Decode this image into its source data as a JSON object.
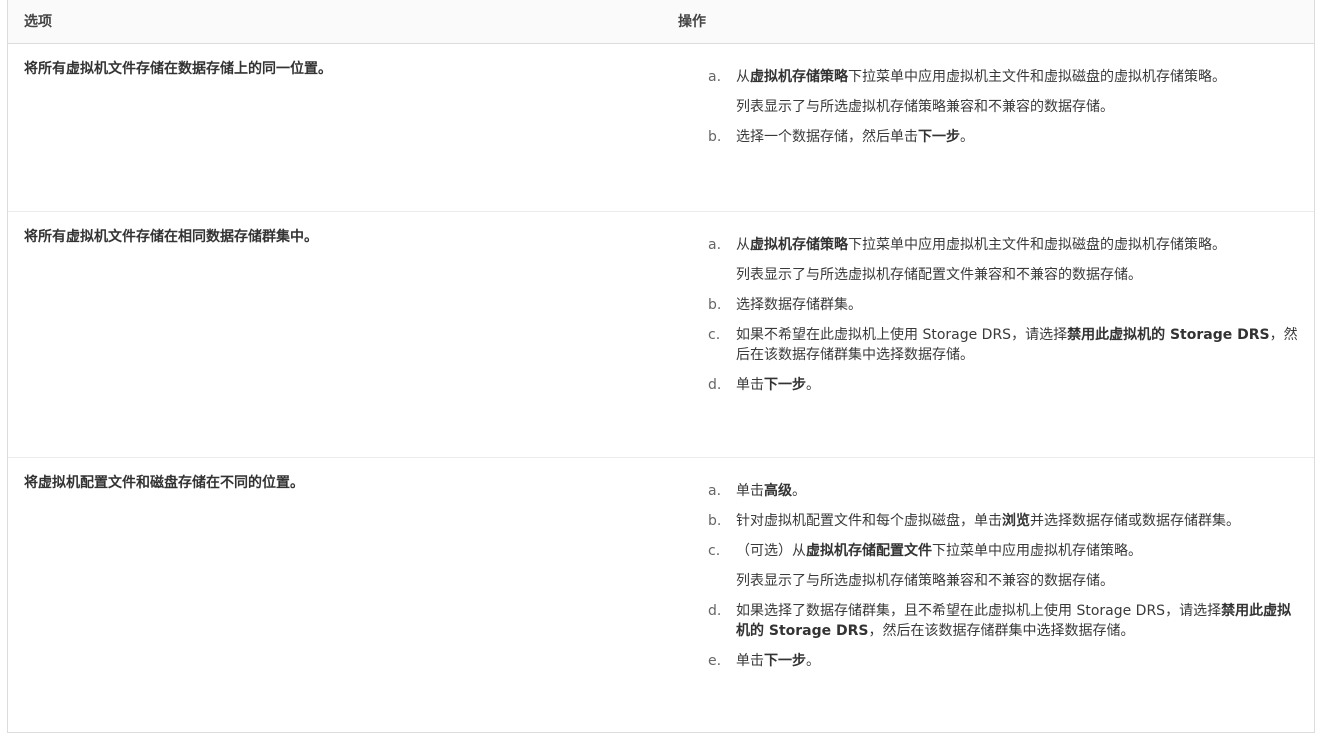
{
  "header": {
    "option": "选项",
    "action": "操作"
  },
  "rows": [
    {
      "option": "将所有虚拟机文件存储在数据存储上的同一位置。",
      "steps": [
        {
          "marker": "a.",
          "parts": [
            {
              "t": "从"
            },
            {
              "t": "虚拟机存储策略",
              "b": true
            },
            {
              "t": "下拉菜单中应用虚拟机主文件和虚拟磁盘的虚拟机存储策略。"
            }
          ],
          "note": "列表显示了与所选虚拟机存储策略兼容和不兼容的数据存储。"
        },
        {
          "marker": "b.",
          "parts": [
            {
              "t": "选择一个数据存储，然后单击"
            },
            {
              "t": "下一步",
              "b": true
            },
            {
              "t": "。"
            }
          ]
        }
      ]
    },
    {
      "option": "将所有虚拟机文件存储在相同数据存储群集中。",
      "steps": [
        {
          "marker": "a.",
          "parts": [
            {
              "t": "从"
            },
            {
              "t": "虚拟机存储策略",
              "b": true
            },
            {
              "t": "下拉菜单中应用虚拟机主文件和虚拟磁盘的虚拟机存储策略。"
            }
          ],
          "note": "列表显示了与所选虚拟机存储配置文件兼容和不兼容的数据存储。"
        },
        {
          "marker": "b.",
          "parts": [
            {
              "t": "选择数据存储群集。"
            }
          ]
        },
        {
          "marker": "c.",
          "parts": [
            {
              "t": "如果不希望在此虚拟机上使用 Storage DRS，请选择"
            },
            {
              "t": "禁用此虚拟机的 Storage DRS",
              "b": true
            },
            {
              "t": "，然后在该数据存储群集中选择数据存储。"
            }
          ]
        },
        {
          "marker": "d.",
          "parts": [
            {
              "t": "单击"
            },
            {
              "t": "下一步",
              "b": true
            },
            {
              "t": "。"
            }
          ]
        }
      ]
    },
    {
      "option": "将虚拟机配置文件和磁盘存储在不同的位置。",
      "steps": [
        {
          "marker": "a.",
          "parts": [
            {
              "t": "单击"
            },
            {
              "t": "高级",
              "b": true
            },
            {
              "t": "。"
            }
          ]
        },
        {
          "marker": "b.",
          "parts": [
            {
              "t": "针对虚拟机配置文件和每个虚拟磁盘，单击"
            },
            {
              "t": "浏览",
              "b": true
            },
            {
              "t": "并选择数据存储或数据存储群集。"
            }
          ]
        },
        {
          "marker": "c.",
          "parts": [
            {
              "t": "（可选）从"
            },
            {
              "t": "虚拟机存储配置文件",
              "b": true
            },
            {
              "t": "下拉菜单中应用虚拟机存储策略。"
            }
          ],
          "note": "列表显示了与所选虚拟机存储策略兼容和不兼容的数据存储。"
        },
        {
          "marker": "d.",
          "parts": [
            {
              "t": "如果选择了数据存储群集，且不希望在此虚拟机上使用 Storage DRS，请选择"
            },
            {
              "t": "禁用此虚拟机的 Storage DRS",
              "b": true
            },
            {
              "t": "，然后在该数据存储群集中选择数据存储。"
            }
          ]
        },
        {
          "marker": "e.",
          "parts": [
            {
              "t": "单击"
            },
            {
              "t": "下一步",
              "b": true
            },
            {
              "t": "。"
            }
          ]
        }
      ]
    }
  ]
}
